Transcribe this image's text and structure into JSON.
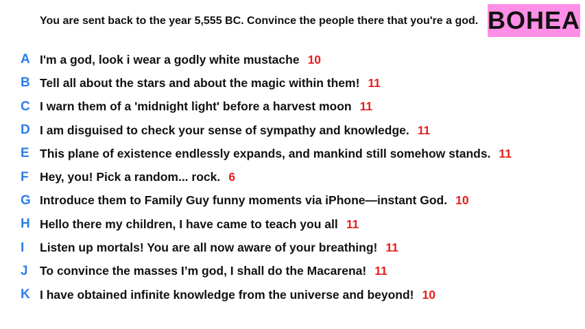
{
  "prompt": "You are sent back to the year 5,555 BC. Convince the people there that you're a god.",
  "logo": "BOHEA",
  "colors": {
    "letter": "#2b7de9",
    "score": "#e61e1e",
    "logo_bg": "#ff8fe6"
  },
  "answers": [
    {
      "letter": "A",
      "text": "I'm a god, look i wear a godly white mustache",
      "score": "10"
    },
    {
      "letter": "B",
      "text": "Tell all about the stars and about the magic within them!",
      "score": "11"
    },
    {
      "letter": "C",
      "text": "I warn them of a 'midnight light' before a harvest moon",
      "score": "11"
    },
    {
      "letter": "D",
      "text": "I am disguised to check your sense of sympathy and knowledge.",
      "score": "11"
    },
    {
      "letter": "E",
      "text": "This plane of existence endlessly expands, and mankind still somehow stands.",
      "score": "11"
    },
    {
      "letter": "F",
      "text": "Hey, you! Pick a random... rock.",
      "score": "6"
    },
    {
      "letter": "G",
      "text": "Introduce them to Family Guy funny moments via iPhone—instant God.",
      "score": "10"
    },
    {
      "letter": "H",
      "text": "Hello there my children, I have came to teach you all",
      "score": "11"
    },
    {
      "letter": "I",
      "text": "Listen up mortals! You are all now aware of your breathing!",
      "score": "11"
    },
    {
      "letter": "J",
      "text": "To convince the masses I’m god, I shall do the Macarena!",
      "score": "11"
    },
    {
      "letter": "K",
      "text": "I have obtained infinite knowledge from the universe and beyond!",
      "score": "10"
    }
  ]
}
